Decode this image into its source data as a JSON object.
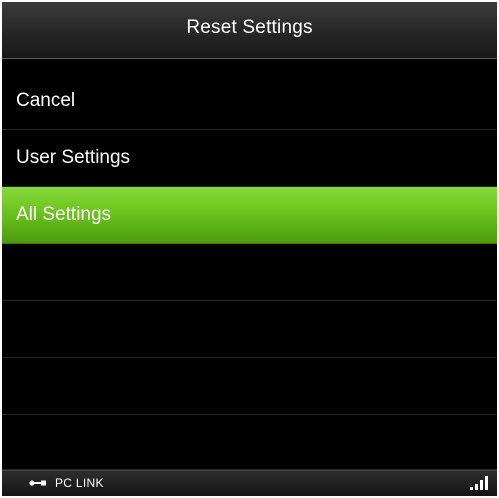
{
  "title": "Reset Settings",
  "menu": {
    "items": [
      {
        "label": "Cancel",
        "selected": false
      },
      {
        "label": "User Settings",
        "selected": false
      },
      {
        "label": "All Settings",
        "selected": true
      }
    ],
    "empty_rows": 4
  },
  "status_bar": {
    "connection_label": "PC LINK",
    "connection_icon": "usb-link-icon",
    "signal_icon": "signal-strength-icon"
  },
  "colors": {
    "background": "#000000",
    "selection": "#6cc41e",
    "text": "#ffffff"
  }
}
